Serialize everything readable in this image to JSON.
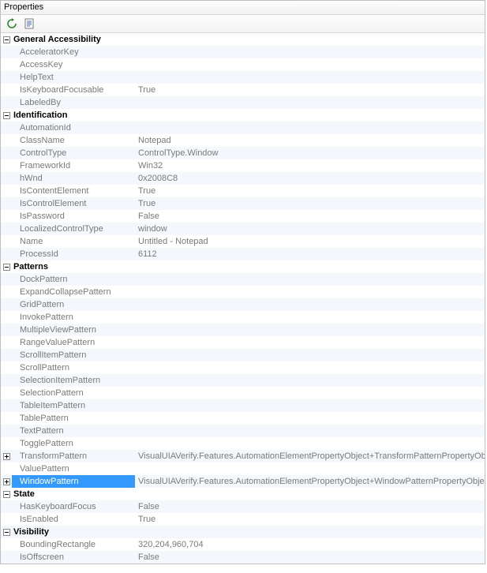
{
  "panel_title": "Properties",
  "toolbar": {
    "refresh_label": "Refresh",
    "view_label": "View"
  },
  "categories": [
    {
      "name": "General Accessibility",
      "expander": "minus",
      "items": [
        {
          "label": "AcceleratorKey",
          "value": ""
        },
        {
          "label": "AccessKey",
          "value": ""
        },
        {
          "label": "HelpText",
          "value": ""
        },
        {
          "label": "IsKeyboardFocusable",
          "value": "True"
        },
        {
          "label": "LabeledBy",
          "value": ""
        }
      ]
    },
    {
      "name": "Identification",
      "expander": "minus",
      "items": [
        {
          "label": "AutomationId",
          "value": ""
        },
        {
          "label": "ClassName",
          "value": "Notepad"
        },
        {
          "label": "ControlType",
          "value": "ControlType.Window"
        },
        {
          "label": "FrameworkId",
          "value": "Win32"
        },
        {
          "label": "hWnd",
          "value": "0x2008C8"
        },
        {
          "label": "IsContentElement",
          "value": "True"
        },
        {
          "label": "IsControlElement",
          "value": "True"
        },
        {
          "label": "IsPassword",
          "value": "False"
        },
        {
          "label": "LocalizedControlType",
          "value": "window"
        },
        {
          "label": "Name",
          "value": "Untitled - Notepad"
        },
        {
          "label": "ProcessId",
          "value": "6112"
        }
      ]
    },
    {
      "name": "Patterns",
      "expander": "minus",
      "items": [
        {
          "label": "DockPattern",
          "value": ""
        },
        {
          "label": "ExpandCollapsePattern",
          "value": ""
        },
        {
          "label": "GridPattern",
          "value": ""
        },
        {
          "label": "InvokePattern",
          "value": ""
        },
        {
          "label": "MultipleViewPattern",
          "value": ""
        },
        {
          "label": "RangeValuePattern",
          "value": ""
        },
        {
          "label": "ScrollItemPattern",
          "value": ""
        },
        {
          "label": "ScrollPattern",
          "value": ""
        },
        {
          "label": "SelectionItemPattern",
          "value": ""
        },
        {
          "label": "SelectionPattern",
          "value": ""
        },
        {
          "label": "TableItemPattern",
          "value": ""
        },
        {
          "label": "TablePattern",
          "value": ""
        },
        {
          "label": "TextPattern",
          "value": ""
        },
        {
          "label": "TogglePattern",
          "value": ""
        },
        {
          "label": "TransformPattern",
          "value": "VisualUIAVerify.Features.AutomationElementPropertyObject+TransformPatternPropertyObject",
          "expander": "plus"
        },
        {
          "label": "ValuePattern",
          "value": ""
        },
        {
          "label": "WindowPattern",
          "value": "VisualUIAVerify.Features.AutomationElementPropertyObject+WindowPatternPropertyObject",
          "expander": "plus",
          "selected": true
        }
      ]
    },
    {
      "name": "State",
      "expander": "minus",
      "items": [
        {
          "label": "HasKeyboardFocus",
          "value": "False"
        },
        {
          "label": "IsEnabled",
          "value": "True"
        }
      ]
    },
    {
      "name": "Visibility",
      "expander": "minus",
      "items": [
        {
          "label": "BoundingRectangle",
          "value": "320,204,960,704"
        },
        {
          "label": "IsOffscreen",
          "value": "False"
        }
      ]
    }
  ]
}
